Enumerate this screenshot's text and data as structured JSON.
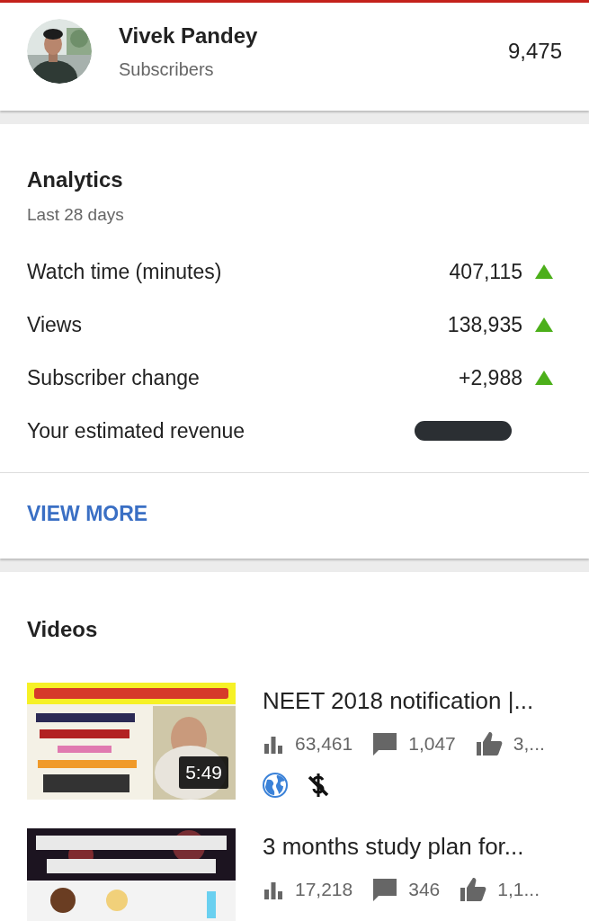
{
  "channel": {
    "name": "Vivek Pandey",
    "subscribers_label": "Subscribers",
    "subscribers": "9,475"
  },
  "analytics": {
    "title": "Analytics",
    "period": "Last 28 days",
    "metrics": [
      {
        "label": "Watch time (minutes)",
        "kind": "value",
        "value": "407,115",
        "rising": true
      },
      {
        "label": "Views",
        "kind": "value",
        "value": "138,935",
        "rising": true
      },
      {
        "label": "Subscriber change",
        "kind": "value",
        "value": "+2,988",
        "rising": true
      },
      {
        "label": "Your estimated revenue",
        "kind": "redacted"
      }
    ],
    "more_button": "VIEW MORE"
  },
  "videos": {
    "title": "Videos",
    "items": [
      {
        "title": "NEET 2018 notification |...",
        "duration": "5:49",
        "views": "63,461",
        "comments": "1,047",
        "likes": "3,...",
        "public": true,
        "monetized": false
      },
      {
        "title": "3 months study plan for...",
        "views": "17,218",
        "comments": "346",
        "likes": "1,1..."
      }
    ]
  }
}
